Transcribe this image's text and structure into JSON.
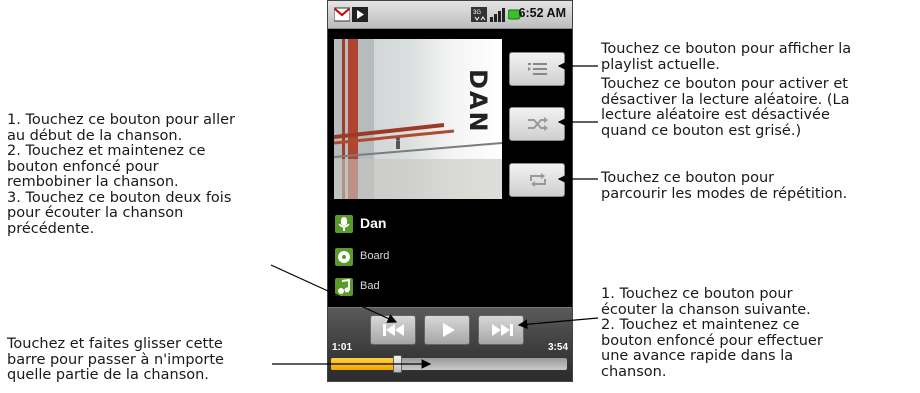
{
  "status_bar": {
    "time": "6:52 AM",
    "icons": [
      "gmail-icon",
      "play-icon",
      "3g-icon",
      "signal-icon",
      "battery-icon"
    ]
  },
  "player": {
    "album_title": "DAN",
    "track": "Dan",
    "album": "Board",
    "artist": "Bad",
    "elapsed": "1:01",
    "duration": "3:54",
    "progress_fraction": 0.28,
    "accent_color": "#f2a700"
  },
  "annotations": {
    "playlist": [
      "Touchez ce bouton pour afficher la",
      "playlist actuelle."
    ],
    "shuffle": [
      "Touchez ce bouton pour activer et",
      "désactiver la lecture aléatoire. (La",
      "lecture aléatoire est désactivée",
      "quand ce bouton est grisé.)"
    ],
    "repeat": [
      "Touchez ce bouton pour",
      "parcourir les modes de répétition."
    ],
    "previous": [
      "1. Touchez ce bouton pour aller",
      "au début de la chanson.",
      "2. Touchez et maintenez ce",
      "bouton enfoncé pour",
      "rembobiner la chanson.",
      "3. Touchez ce bouton deux fois",
      "pour écouter la chanson",
      "précédente."
    ],
    "seek": [
      "Touchez et faites glisser cette",
      "barre pour passer à n'importe",
      "quelle partie de la chanson."
    ],
    "next": [
      "1. Touchez ce bouton pour",
      "écouter la chanson suivante.",
      "2. Touchez et maintenez ce",
      "bouton enfoncé pour effectuer",
      "une avance rapide dans la",
      "chanson."
    ]
  }
}
